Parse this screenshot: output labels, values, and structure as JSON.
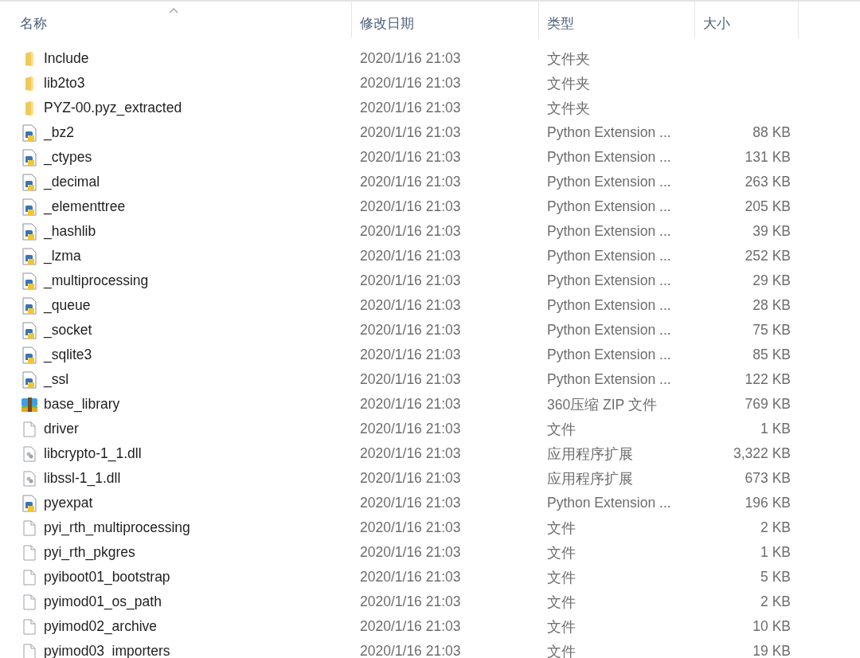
{
  "columns": [
    {
      "label": "名称",
      "sorted": true
    },
    {
      "label": "修改日期",
      "sorted": false
    },
    {
      "label": "类型",
      "sorted": false
    },
    {
      "label": "大小",
      "sorted": false
    }
  ],
  "rows": [
    {
      "kind": "folder",
      "name": "Include",
      "date": "2020/1/16 21:03",
      "type": "文件夹"
    },
    {
      "kind": "folder",
      "name": "lib2to3",
      "date": "2020/1/16 21:03",
      "type": "文件夹"
    },
    {
      "kind": "folder",
      "name": "PYZ-00.pyz_extracted",
      "date": "2020/1/16 21:03",
      "type": "文件夹"
    },
    {
      "kind": "python",
      "name": "_bz2",
      "date": "2020/1/16 21:03",
      "type": "Python Extension ...",
      "size": "88 KB"
    },
    {
      "kind": "python",
      "name": "_ctypes",
      "date": "2020/1/16 21:03",
      "type": "Python Extension ...",
      "size": "131 KB"
    },
    {
      "kind": "python",
      "name": "_decimal",
      "date": "2020/1/16 21:03",
      "type": "Python Extension ...",
      "size": "263 KB"
    },
    {
      "kind": "python",
      "name": "_elementtree",
      "date": "2020/1/16 21:03",
      "type": "Python Extension ...",
      "size": "205 KB"
    },
    {
      "kind": "python",
      "name": "_hashlib",
      "date": "2020/1/16 21:03",
      "type": "Python Extension ...",
      "size": "39 KB"
    },
    {
      "kind": "python",
      "name": "_lzma",
      "date": "2020/1/16 21:03",
      "type": "Python Extension ...",
      "size": "252 KB"
    },
    {
      "kind": "python",
      "name": "_multiprocessing",
      "date": "2020/1/16 21:03",
      "type": "Python Extension ...",
      "size": "29 KB"
    },
    {
      "kind": "python",
      "name": "_queue",
      "date": "2020/1/16 21:03",
      "type": "Python Extension ...",
      "size": "28 KB"
    },
    {
      "kind": "python",
      "name": "_socket",
      "date": "2020/1/16 21:03",
      "type": "Python Extension ...",
      "size": "75 KB"
    },
    {
      "kind": "python",
      "name": "_sqlite3",
      "date": "2020/1/16 21:03",
      "type": "Python Extension ...",
      "size": "85 KB"
    },
    {
      "kind": "python",
      "name": "_ssl",
      "date": "2020/1/16 21:03",
      "type": "Python Extension ...",
      "size": "122 KB"
    },
    {
      "kind": "archive",
      "name": "base_library",
      "date": "2020/1/16 21:03",
      "type": "360压缩 ZIP 文件",
      "size": "769 KB"
    },
    {
      "kind": "file",
      "name": "driver",
      "date": "2020/1/16 21:03",
      "type": "文件",
      "size": "1 KB"
    },
    {
      "kind": "dll",
      "name": "libcrypto-1_1.dll",
      "date": "2020/1/16 21:03",
      "type": "应用程序扩展",
      "size": "3,322 KB"
    },
    {
      "kind": "dll",
      "name": "libssl-1_1.dll",
      "date": "2020/1/16 21:03",
      "type": "应用程序扩展",
      "size": "673 KB"
    },
    {
      "kind": "python",
      "name": "pyexpat",
      "date": "2020/1/16 21:03",
      "type": "Python Extension ...",
      "size": "196 KB"
    },
    {
      "kind": "file",
      "name": "pyi_rth_multiprocessing",
      "date": "2020/1/16 21:03",
      "type": "文件",
      "size": "2 KB"
    },
    {
      "kind": "file",
      "name": "pyi_rth_pkgres",
      "date": "2020/1/16 21:03",
      "type": "文件",
      "size": "1 KB"
    },
    {
      "kind": "file",
      "name": "pyiboot01_bootstrap",
      "date": "2020/1/16 21:03",
      "type": "文件",
      "size": "5 KB"
    },
    {
      "kind": "file",
      "name": "pyimod01_os_path",
      "date": "2020/1/16 21:03",
      "type": "文件",
      "size": "2 KB"
    },
    {
      "kind": "file",
      "name": "pyimod02_archive",
      "date": "2020/1/16 21:03",
      "type": "文件",
      "size": "10 KB"
    },
    {
      "kind": "file",
      "name": "pyimod03_importers",
      "date": "2020/1/16 21:03",
      "type": "文件",
      "size": "19 KB"
    }
  ]
}
